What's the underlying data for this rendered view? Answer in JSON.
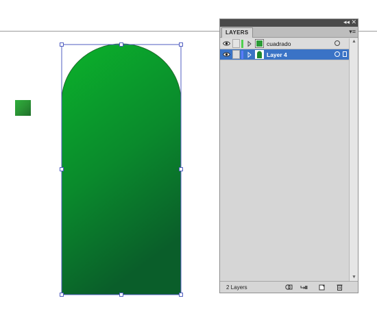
{
  "panel": {
    "tab_label": "LAYERS",
    "collapse_glyph": "◂◂",
    "close_glyph": "✕",
    "menu_glyph": "▾≡",
    "footer_count": "2 Layers"
  },
  "layers": [
    {
      "name": "cuadrado",
      "color": "#4fd04f",
      "selected": false,
      "thumb_color": "#2a9a36"
    },
    {
      "name": "Layer 4",
      "color": "#5a7bff",
      "selected": true,
      "thumb_color": "#1e8a2e"
    }
  ],
  "colors": {
    "shape_gradient_top": "#0bb22b",
    "shape_gradient_bottom": "#0a5e2a",
    "selection_blue": "#3a73c6",
    "bounding_box": "#4f5cc0"
  },
  "icons": {
    "visibility": "eye-icon",
    "disclosure": "triangle-right-icon",
    "target": "target-circle-icon",
    "footer": [
      "make-clipping-mask-icon",
      "create-sublayer-icon",
      "new-layer-icon",
      "delete-icon"
    ]
  }
}
